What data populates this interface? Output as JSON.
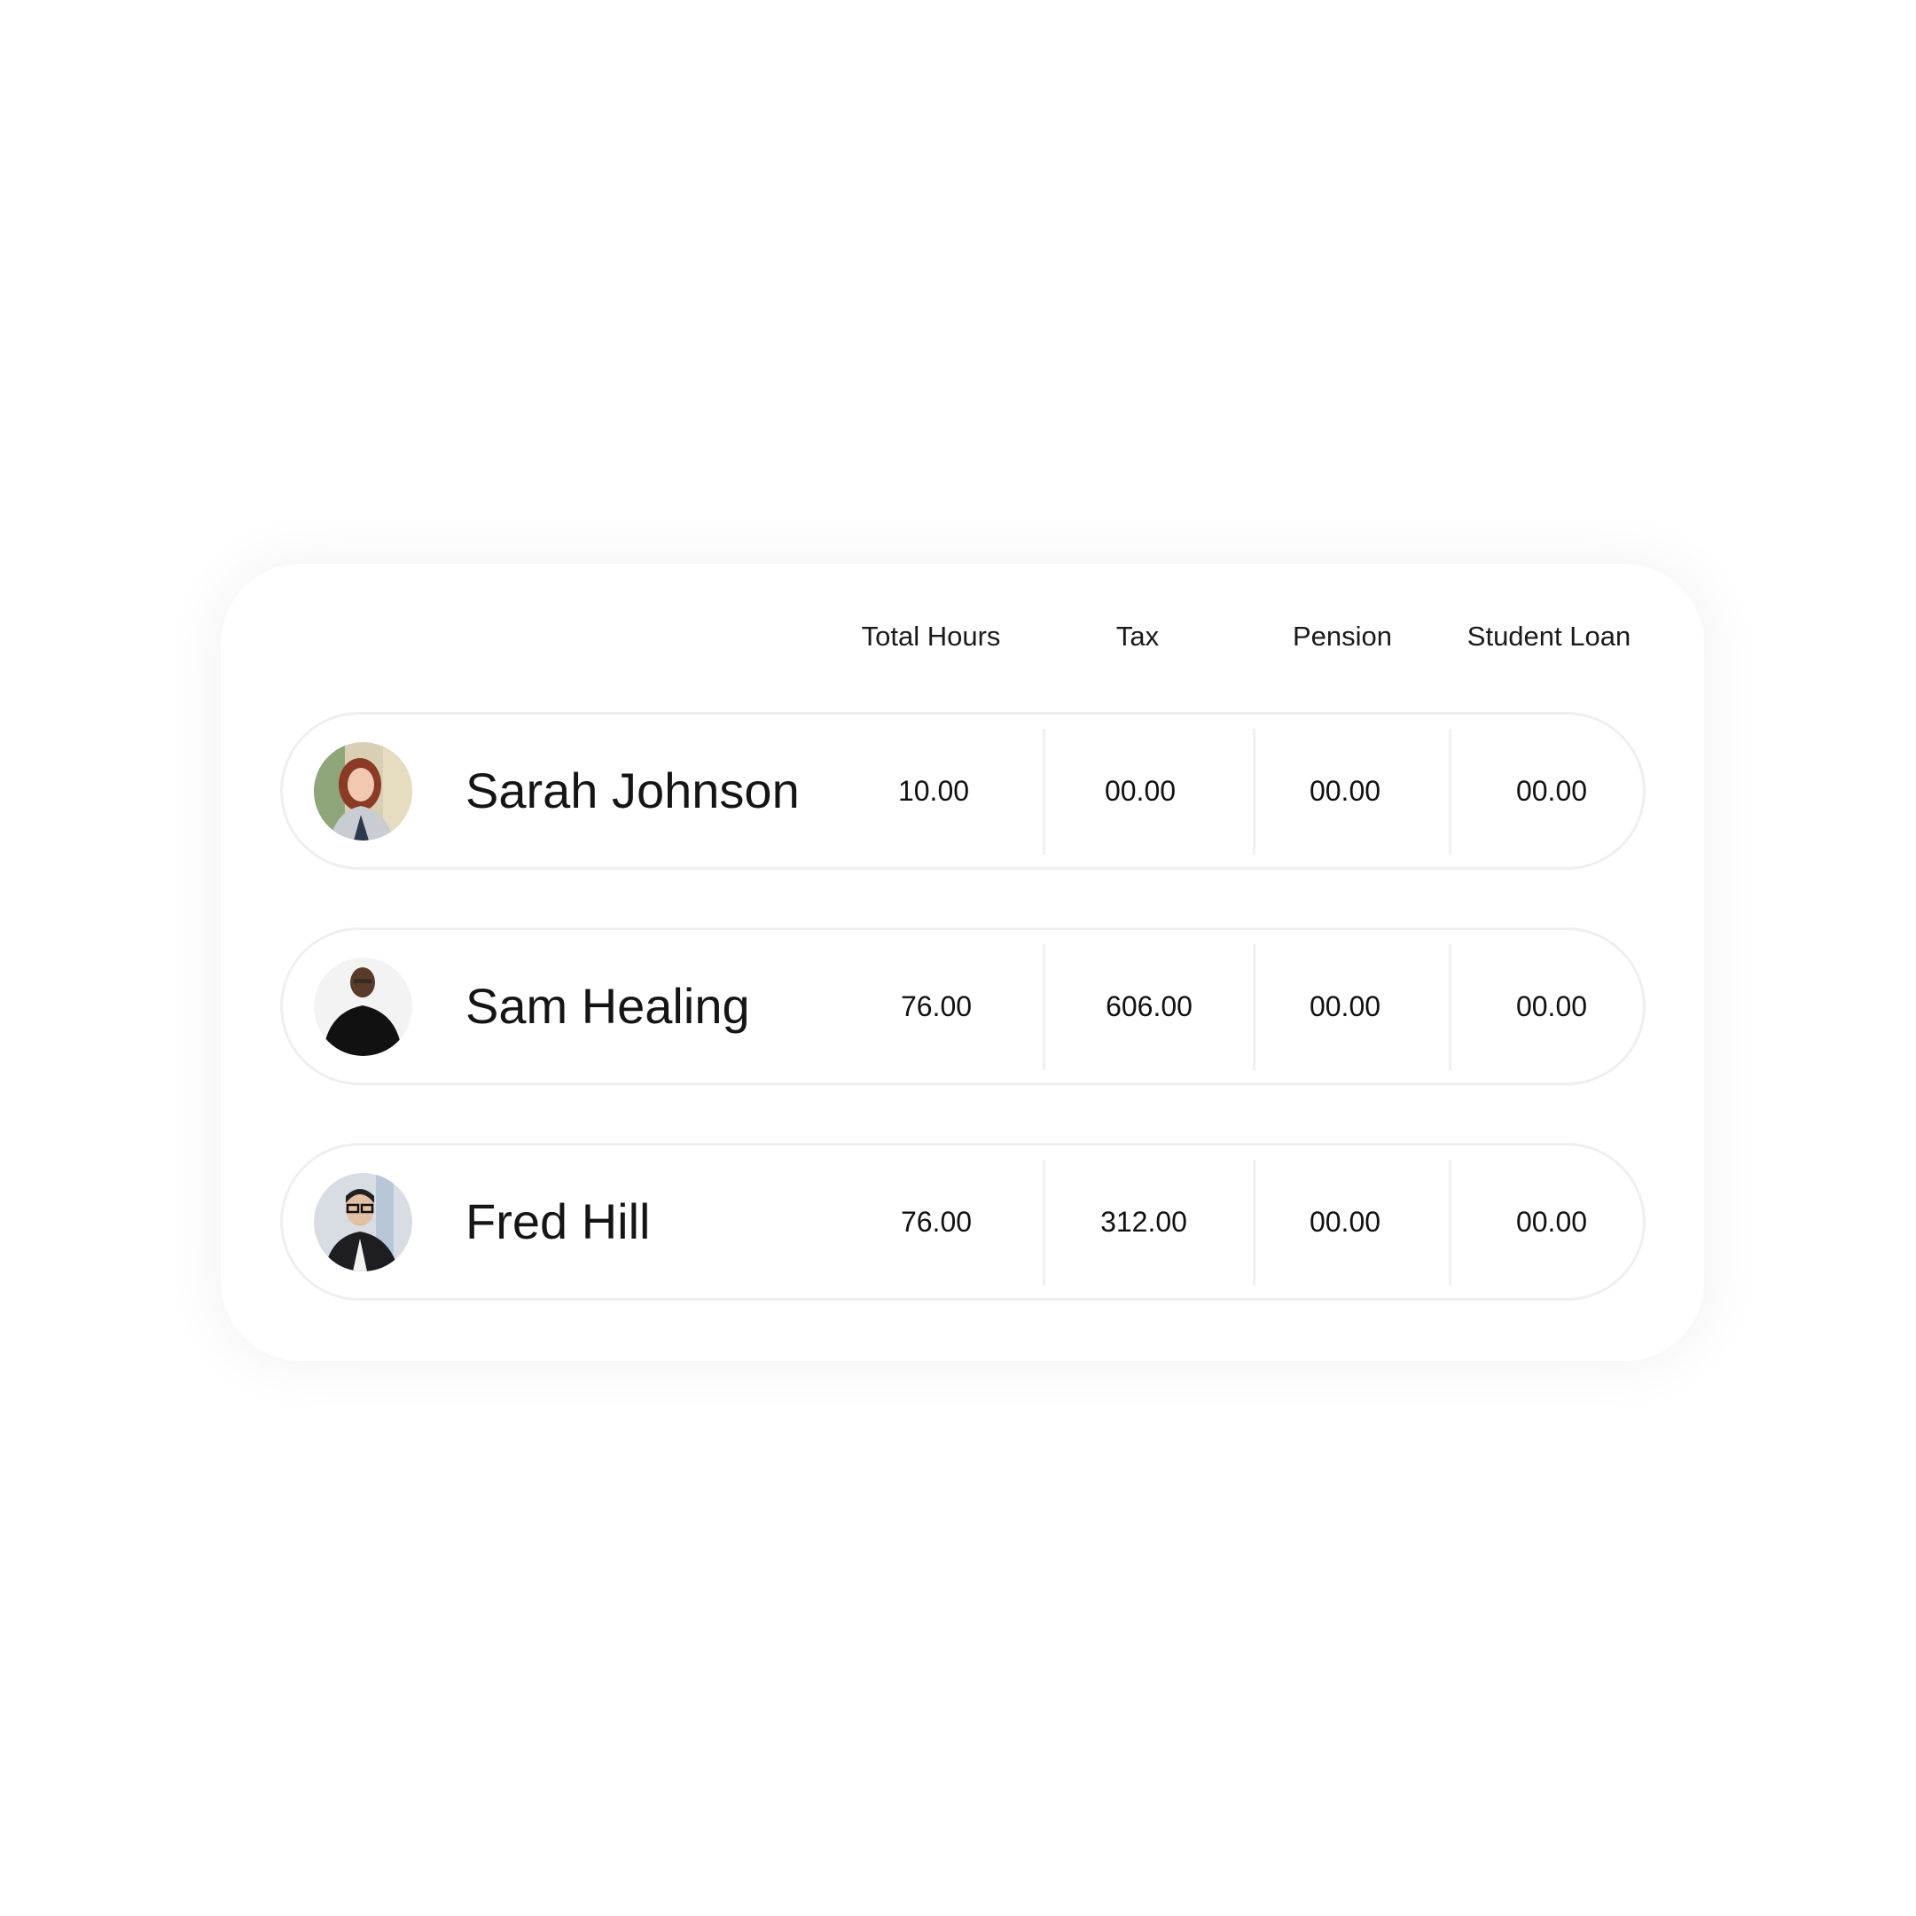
{
  "table": {
    "columns": [
      "Total Hours",
      "Tax",
      "Pension",
      "Student Loan"
    ],
    "rows": [
      {
        "name": "Sarah Johnson",
        "avatar": "avatar-photo-woman-red-hair",
        "total_hours": "10.00",
        "tax": "00.00",
        "pension": "00.00",
        "student_loan": "00.00"
      },
      {
        "name": "Sam Healing",
        "avatar": "avatar-photo-man-black-shirt",
        "total_hours": "76.00",
        "tax": "606.00",
        "pension": "00.00",
        "student_loan": "00.00"
      },
      {
        "name": "Fred Hill",
        "avatar": "avatar-photo-man-glasses",
        "total_hours": "76.00",
        "tax": "312.00",
        "pension": "00.00",
        "student_loan": "00.00"
      }
    ]
  },
  "colors": {
    "row_border": "#efefef",
    "text": "#141414",
    "background": "#ffffff"
  }
}
